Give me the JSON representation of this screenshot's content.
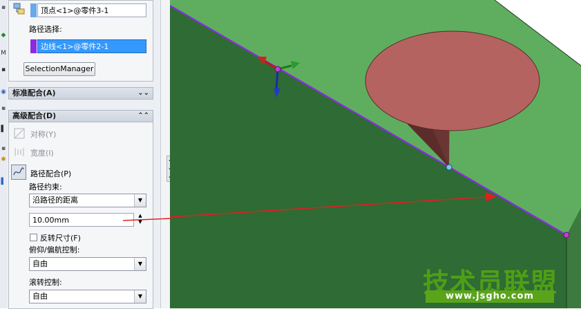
{
  "selection": {
    "vertex_field": "顶点<1>@零件3-1",
    "path_label": "路径选择:",
    "path_field": "边线<1>@零件2-1",
    "selection_manager_button": "SelectionManager"
  },
  "sections": {
    "standard_mates": "标准配合(A)",
    "advanced_mates": "高级配合(D)"
  },
  "advanced": {
    "symmetric": "对称(Y)",
    "width": "宽度(I)",
    "path_mate": "路径配合(P)",
    "path_constraint_label": "路径约束:",
    "path_constraint_value": "沿路径的距离",
    "distance_value": "10.00mm",
    "reverse_dimension": "反转尺寸(F)",
    "pitch_yaw_label": "俯仰/偏航控制:",
    "pitch_yaw_value": "自由",
    "roll_label": "滚转控制:",
    "roll_value": "自由"
  },
  "watermark": {
    "text": "技术员联盟",
    "url": "www.jsgho.com"
  },
  "colors": {
    "face_light": "#5fae5f",
    "face_dark": "#2f6b34",
    "cone_top": "#b46361",
    "cone_side": "#6a3533",
    "edge_highlight": "#8a2be2",
    "annotation_arrow": "#e02020"
  }
}
